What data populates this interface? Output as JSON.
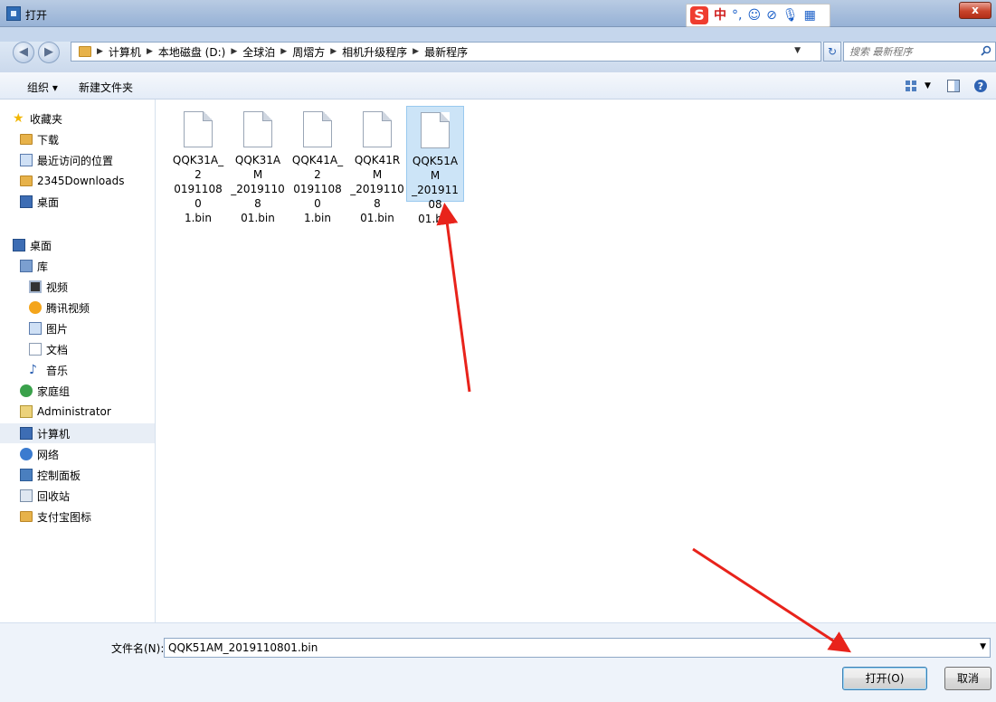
{
  "window": {
    "title": "打开",
    "close_label": "x"
  },
  "ime": {
    "logo": "S",
    "items": [
      "中",
      "°,",
      "☺",
      "⊘",
      "🎙",
      "▦"
    ]
  },
  "address_bar": {
    "segments": [
      "计算机",
      "本地磁盘 (D:)",
      "全球泊",
      "周熠方",
      "相机升级程序",
      "最新程序"
    ],
    "search_placeholder": "搜索 最新程序"
  },
  "toolbar": {
    "organize_label": "组织 ▾",
    "new_folder_label": "新建文件夹"
  },
  "nav_pane": {
    "items": [
      {
        "label": "收藏夹",
        "icon": "star-icon"
      },
      {
        "label": "下载",
        "icon": "download-folder-icon"
      },
      {
        "label": "最近访问的位置",
        "icon": "recent-places-icon"
      },
      {
        "label": "2345Downloads",
        "icon": "folder-icon"
      },
      {
        "label": "桌面",
        "icon": "desktop-icon"
      },
      {
        "label": "桌面",
        "icon": "desktop-icon"
      },
      {
        "label": "库",
        "icon": "library-icon"
      },
      {
        "label": "视频",
        "icon": "video-library-icon"
      },
      {
        "label": "腾讯视频",
        "icon": "tencent-video-icon"
      },
      {
        "label": "图片",
        "icon": "pictures-library-icon"
      },
      {
        "label": "文档",
        "icon": "documents-library-icon"
      },
      {
        "label": "音乐",
        "icon": "music-library-icon"
      },
      {
        "label": "家庭组",
        "icon": "homegroup-icon"
      },
      {
        "label": "Administrator",
        "icon": "user-folder-icon"
      },
      {
        "label": "计算机",
        "icon": "computer-icon"
      },
      {
        "label": "网络",
        "icon": "network-icon"
      },
      {
        "label": "控制面板",
        "icon": "control-panel-icon"
      },
      {
        "label": "回收站",
        "icon": "recycle-bin-icon"
      },
      {
        "label": "支付宝图标",
        "icon": "folder-icon"
      }
    ]
  },
  "files": [
    {
      "name": "QQK31A_2019110801.bin",
      "line1": "QQK31A_2",
      "line2": "01911080",
      "line3": "1.bin"
    },
    {
      "name": "QQK31AM_2019110801.bin",
      "line1": "QQK31AM",
      "line2": "_20191108",
      "line3": "01.bin"
    },
    {
      "name": "QQK41A_2019110801.bin",
      "line1": "QQK41A_2",
      "line2": "01911080",
      "line3": "1.bin"
    },
    {
      "name": "QQK41RM_2019110801.bin",
      "line1": "QQK41RM",
      "line2": "_20191108",
      "line3": "01.bin"
    },
    {
      "name": "QQK51AM_2019110801.bin",
      "line1": "QQK51AM",
      "line2": "_20191108",
      "line3": "01.bin",
      "selected": true
    }
  ],
  "footer": {
    "filename_label": "文件名(N):",
    "filename_value": "QQK51AM_2019110801.bin",
    "open_label": "打开(O)",
    "cancel_label": "取消"
  },
  "colors": {
    "annotation_red": "#e8231b",
    "selection_bg": "#cce4f7"
  }
}
